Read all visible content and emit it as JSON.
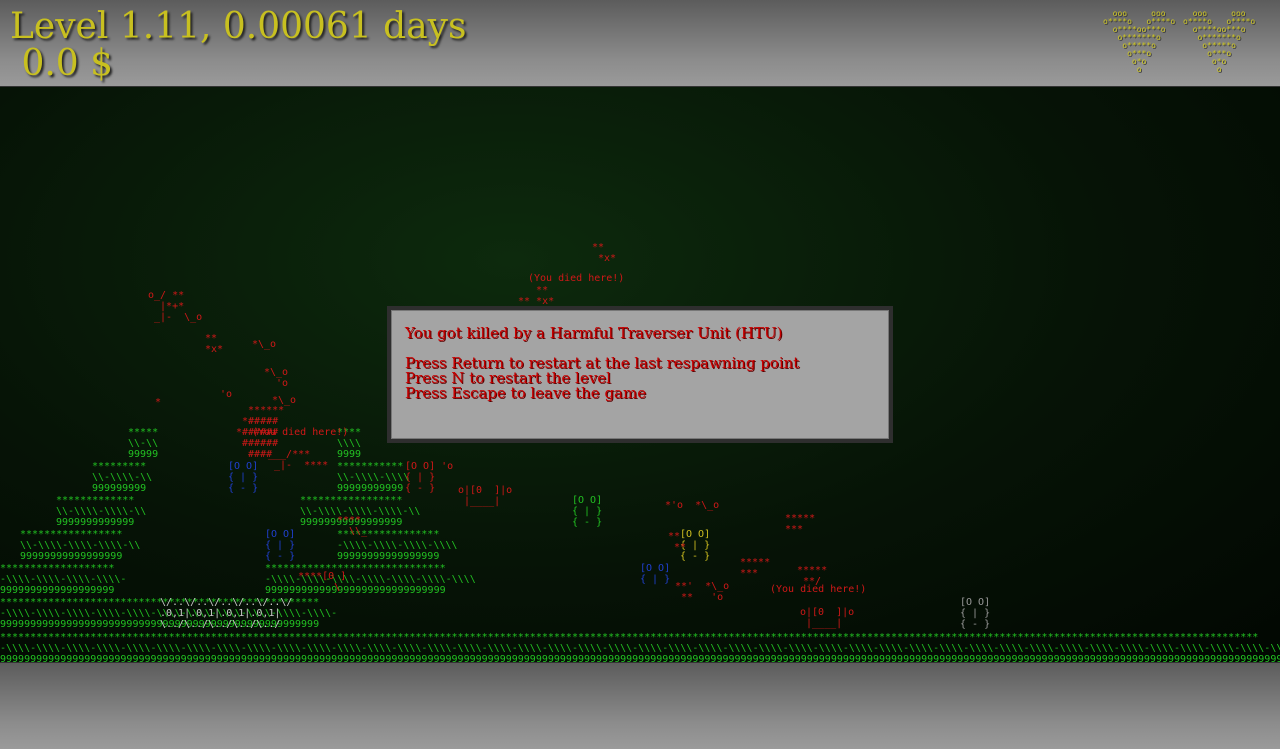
{
  "hud": {
    "level_text": "Level 1.11, 0.00061 days",
    "money_text": " 0.0 $",
    "lives_icon": "heart-ascii-icon",
    "lives_count": 2,
    "life_art": "ooo     ooo\no****o   o****o\no****oo***o\no*******o\no*****o\no***o\no*o\no"
  },
  "dialog": {
    "title": "You got killed by a Harmful Traverser Unit (HTU)",
    "options": [
      "Press Return to restart at the last respawning point",
      "Press N to restart the level",
      "Press Escape to leave the game"
    ]
  },
  "death_markers": [
    "(You died here!)",
    "(You died here!)",
    "(You died here!)",
    "(You died here!)"
  ],
  "colors": {
    "hud_text": "#c8c020",
    "dialog_text": "#c80000",
    "dialog_bg": "#a4a4a4",
    "terrain": "#22c022",
    "enemy": "#d01818"
  }
}
